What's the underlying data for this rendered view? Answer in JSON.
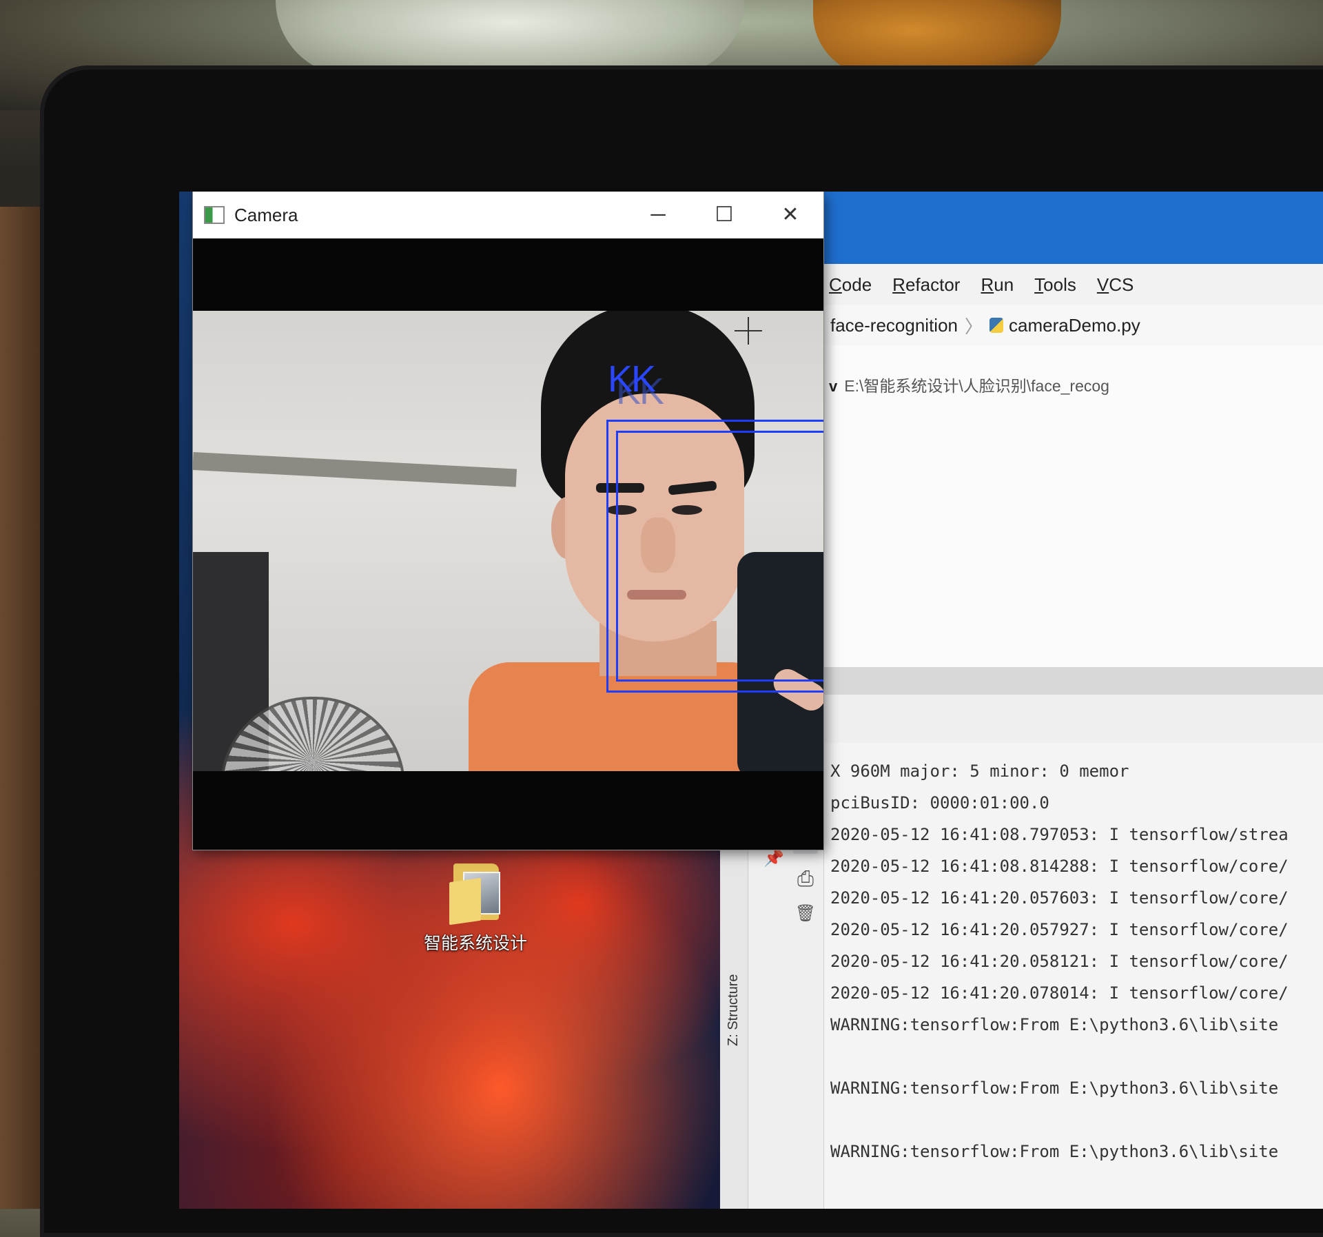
{
  "camera_window": {
    "title": "Camera",
    "minimize_glyph": "─",
    "maximize_glyph": "☐",
    "close_glyph": "✕",
    "face_label": "KK"
  },
  "desktop": {
    "folder_label": "智能系统设计"
  },
  "ide": {
    "menu": [
      "Code",
      "Refactor",
      "Run",
      "Tools",
      "VCS"
    ],
    "breadcrumb": {
      "project": "face-recognition",
      "file": "cameraDemo.py"
    },
    "project_root_marker": "v",
    "project_root_path": "E:\\智能系统设计\\人脸识别\\face_recog",
    "structure_tab_label": "Z: Structure",
    "console_lines": [
      "X 960M major: 5 minor: 0 memor",
      "pciBusID: 0000:01:00.0",
      "2020-05-12 16:41:08.797053: I tensorflow/strea",
      "2020-05-12 16:41:08.814288: I tensorflow/core/",
      "2020-05-12 16:41:20.057603: I tensorflow/core/",
      "2020-05-12 16:41:20.057927: I tensorflow/core/",
      "2020-05-12 16:41:20.058121: I tensorflow/core/",
      "2020-05-12 16:41:20.078014: I tensorflow/core/",
      "WARNING:tensorflow:From E:\\python3.6\\lib\\site",
      "",
      "WARNING:tensorflow:From E:\\python3.6\\lib\\site",
      "",
      "WARNING:tensorflow:From E:\\python3.6\\lib\\site"
    ],
    "tool_icons": {
      "stop": "stop-icon",
      "layout": "▦",
      "pin": "📌",
      "scroll_down": "↓",
      "soft_wrap": "⥱",
      "scroll_to_end": "⤓",
      "print": "⎙",
      "trash": "🗑"
    }
  }
}
